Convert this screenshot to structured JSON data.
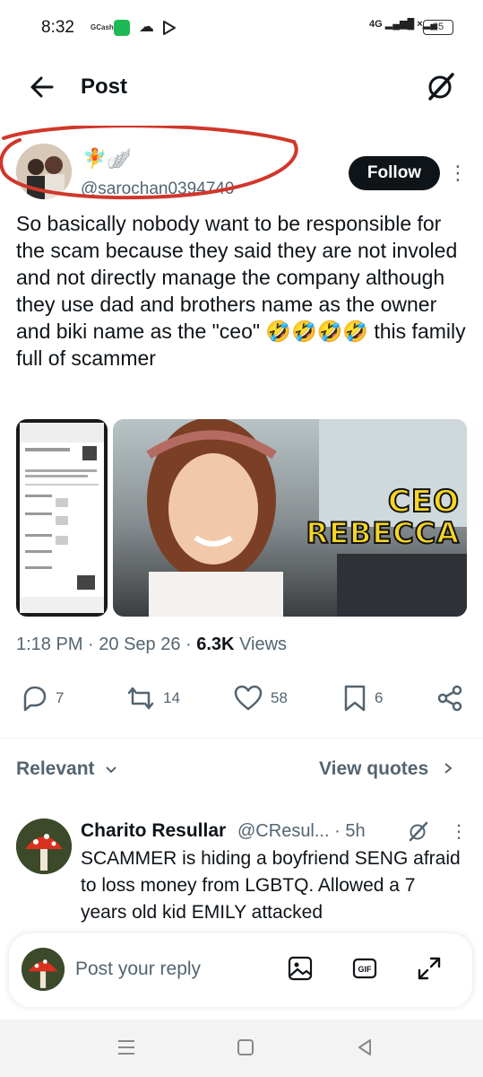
{
  "status_bar": {
    "time": "8:32",
    "gcash_label": "GCash",
    "network": "4G",
    "battery": "35"
  },
  "header": {
    "title": "Post"
  },
  "post": {
    "author_emojis": "🧚🪽",
    "handle": "@sarochan0394740",
    "follow_label": "Follow",
    "text": "So basically nobody want to be responsible for the scam because they said they are not involed and not directly manage the company although they use dad and brothers name as the owner and biki name as the \"ceo\" 🤣🤣🤣🤣 this family full of scammer",
    "media_overlay_line1": "CEO",
    "media_overlay_line2": "REBECCA",
    "time": "1:18 PM",
    "date": "20 Sep 26",
    "views_count": "6.3K",
    "views_label": "Views",
    "replies": "7",
    "reposts": "14",
    "likes": "58",
    "bookmarks": "6"
  },
  "filters": {
    "relevant_label": "Relevant",
    "view_quotes_label": "View quotes"
  },
  "reply": {
    "name": "Charito Resullar",
    "handle": "@CResul... · 5h",
    "text": "SCAMMER is hiding a boyfriend SENG afraid to loss money from LGBTQ. Allowed a 7 years old kid EMILY attacked"
  },
  "composer": {
    "placeholder": "Post your reply"
  },
  "colors": {
    "accent": "#0f1419",
    "secondary_text": "#536471",
    "annotation": "#d0372a"
  }
}
